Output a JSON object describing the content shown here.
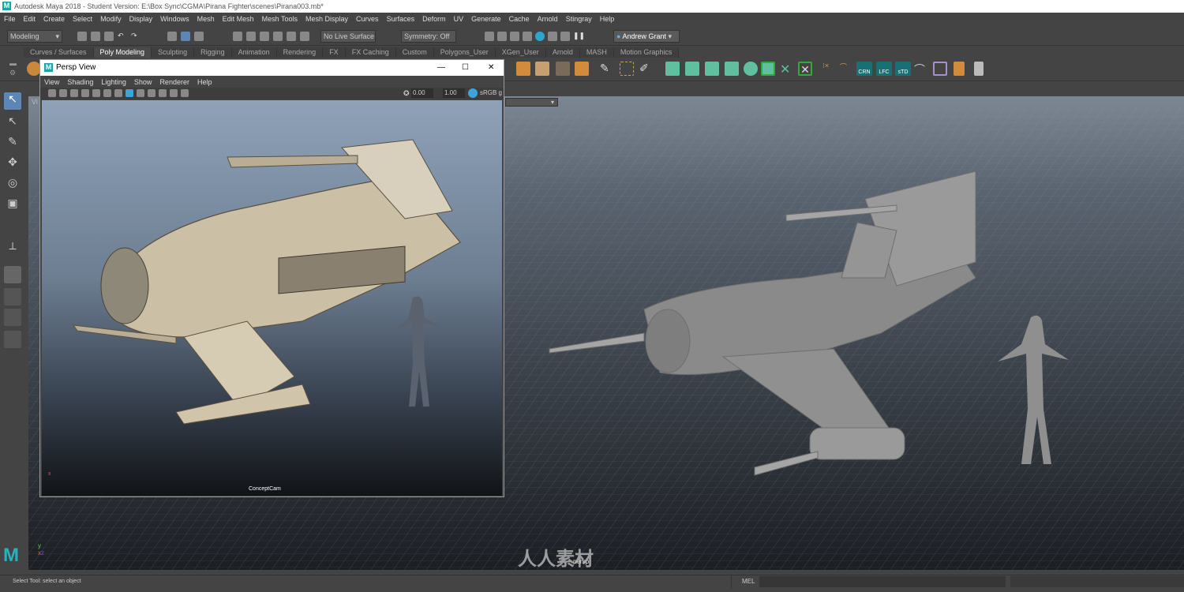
{
  "window": {
    "title": "Autodesk Maya 2018 - Student Version: E:\\Box Sync\\CGMA\\Pirana Fighter\\scenes\\Pirana003.mb*",
    "logo": "M"
  },
  "menubar": [
    "File",
    "Edit",
    "Create",
    "Select",
    "Modify",
    "Display",
    "Windows",
    "Mesh",
    "Edit Mesh",
    "Mesh Tools",
    "Mesh Display",
    "Curves",
    "Surfaces",
    "Deform",
    "UV",
    "Generate",
    "Cache",
    "Arnold",
    "Stingray",
    "Help"
  ],
  "statusline": {
    "menuset": "Modeling",
    "live_surface": "No Live Surface",
    "symmetry": "Symmetry: Off",
    "user": "Andrew Grant"
  },
  "shelf": {
    "tabs": [
      "Curves / Surfaces",
      "Poly Modeling",
      "Sculpting",
      "Rigging",
      "Animation",
      "Rendering",
      "FX",
      "FX Caching",
      "Custom",
      "Polygons_User",
      "XGen_User",
      "Arnold",
      "MASH",
      "Motion Graphics"
    ],
    "active_tab": "Poly Modeling",
    "labels": [
      "CRN",
      "LFC",
      "sTD"
    ],
    "accent": "#5fbf9f"
  },
  "persp_window": {
    "title": "Persp View",
    "menu": [
      "View",
      "Shading",
      "Lighting",
      "Show",
      "Renderer",
      "Help"
    ],
    "exposure": "0.00",
    "gamma": "1.00",
    "colorspace": "sRGB g",
    "camera": "ConceptCam",
    "controls": {
      "minimize": "—",
      "maximize": "☐",
      "close": "✕"
    }
  },
  "viewport": {
    "camera": "persp",
    "label_prefix": "Vi"
  },
  "helpline": {
    "text": "Select Tool: select an object",
    "cmd_lang": "MEL"
  },
  "watermark": "人人素材"
}
